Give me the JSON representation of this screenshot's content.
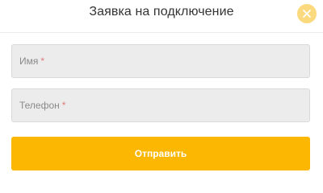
{
  "modal": {
    "title": "Заявка на подключение",
    "close_icon": "close-icon"
  },
  "form": {
    "name_field": {
      "label": "Имя",
      "required_mark": "*"
    },
    "phone_field": {
      "label": "Телефон",
      "required_mark": "*"
    },
    "submit_label": "Отправить"
  },
  "colors": {
    "accent": "#fbb702",
    "close_bg": "#fbd97e",
    "field_bg": "#ececec",
    "required": "#e07b7b"
  }
}
